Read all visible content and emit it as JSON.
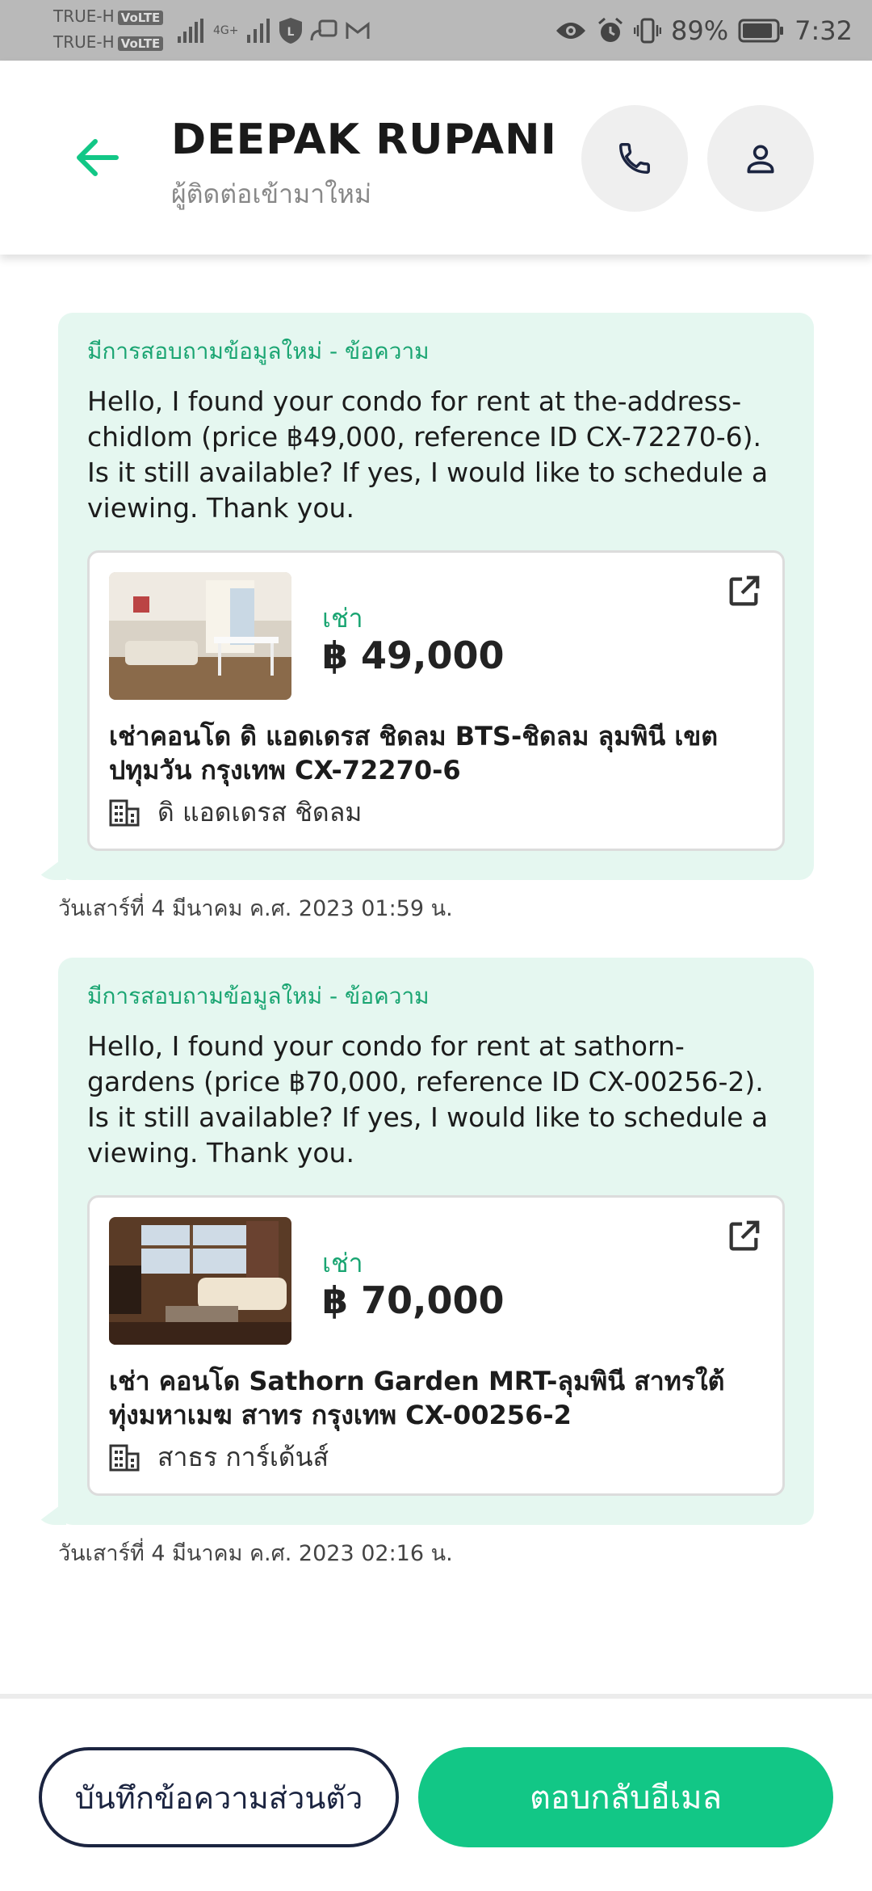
{
  "status_bar": {
    "carrier_1": "TRUE-H",
    "carrier_2": "TRUE-H",
    "volte": "VoLTE",
    "network": "4G+",
    "battery": "89%",
    "time": "7:32"
  },
  "header": {
    "name": "DEEPAK RUPANI",
    "subtitle": "ผู้ติดต่อเข้ามาใหม่",
    "back_icon": "arrow-left-icon",
    "call_icon": "phone-icon",
    "profile_icon": "person-icon"
  },
  "messages": [
    {
      "label": "มีการสอบถามข้อมูลใหม่ - ข้อความ",
      "text": "Hello, I found your condo for rent at the-address-chidlom (price ฿49,000, reference ID CX-72270-6). Is it still available? If yes, I would like to schedule a viewing. Thank you.",
      "card": {
        "deal_type": "เช่า",
        "price": "฿ 49,000",
        "title": "เช่าคอนโด  ดิ แอดเดรส ชิดลม BTS-ชิดลม ลุมพินี เขต ปทุมวัน กรุงเทพ CX-72270-6",
        "building": "ดิ แอดเดรส ชิดลม"
      },
      "timestamp": "วันเสาร์ที่ 4 มีนาคม ค.ศ. 2023 01:59 น."
    },
    {
      "label": "มีการสอบถามข้อมูลใหม่ - ข้อความ",
      "text": "Hello, I found your condo for rent at sathorn-gardens (price ฿70,000, reference ID CX-00256-2). Is it still available? If yes, I would like to schedule a viewing. Thank you.",
      "card": {
        "deal_type": "เช่า",
        "price": "฿ 70,000",
        "title": "เช่า คอนโด  Sathorn Garden MRT-ลุมพินี สาทรใต้ ทุ่งมหาเมฆ สาทร กรุงเทพ CX-00256-2",
        "building": "สาธร การ์เด้นส์"
      },
      "timestamp": "วันเสาร์ที่ 4 มีนาคม ค.ศ. 2023 02:16 น."
    }
  ],
  "actions": {
    "private_note": "บันทึกข้อความส่วนตัว",
    "reply_email": "ตอบกลับอีเมล"
  },
  "colors": {
    "accent": "#12c786",
    "bubble_bg": "#e5f7f0",
    "label_green": "#1aa572",
    "dark_navy": "#1b2440"
  }
}
